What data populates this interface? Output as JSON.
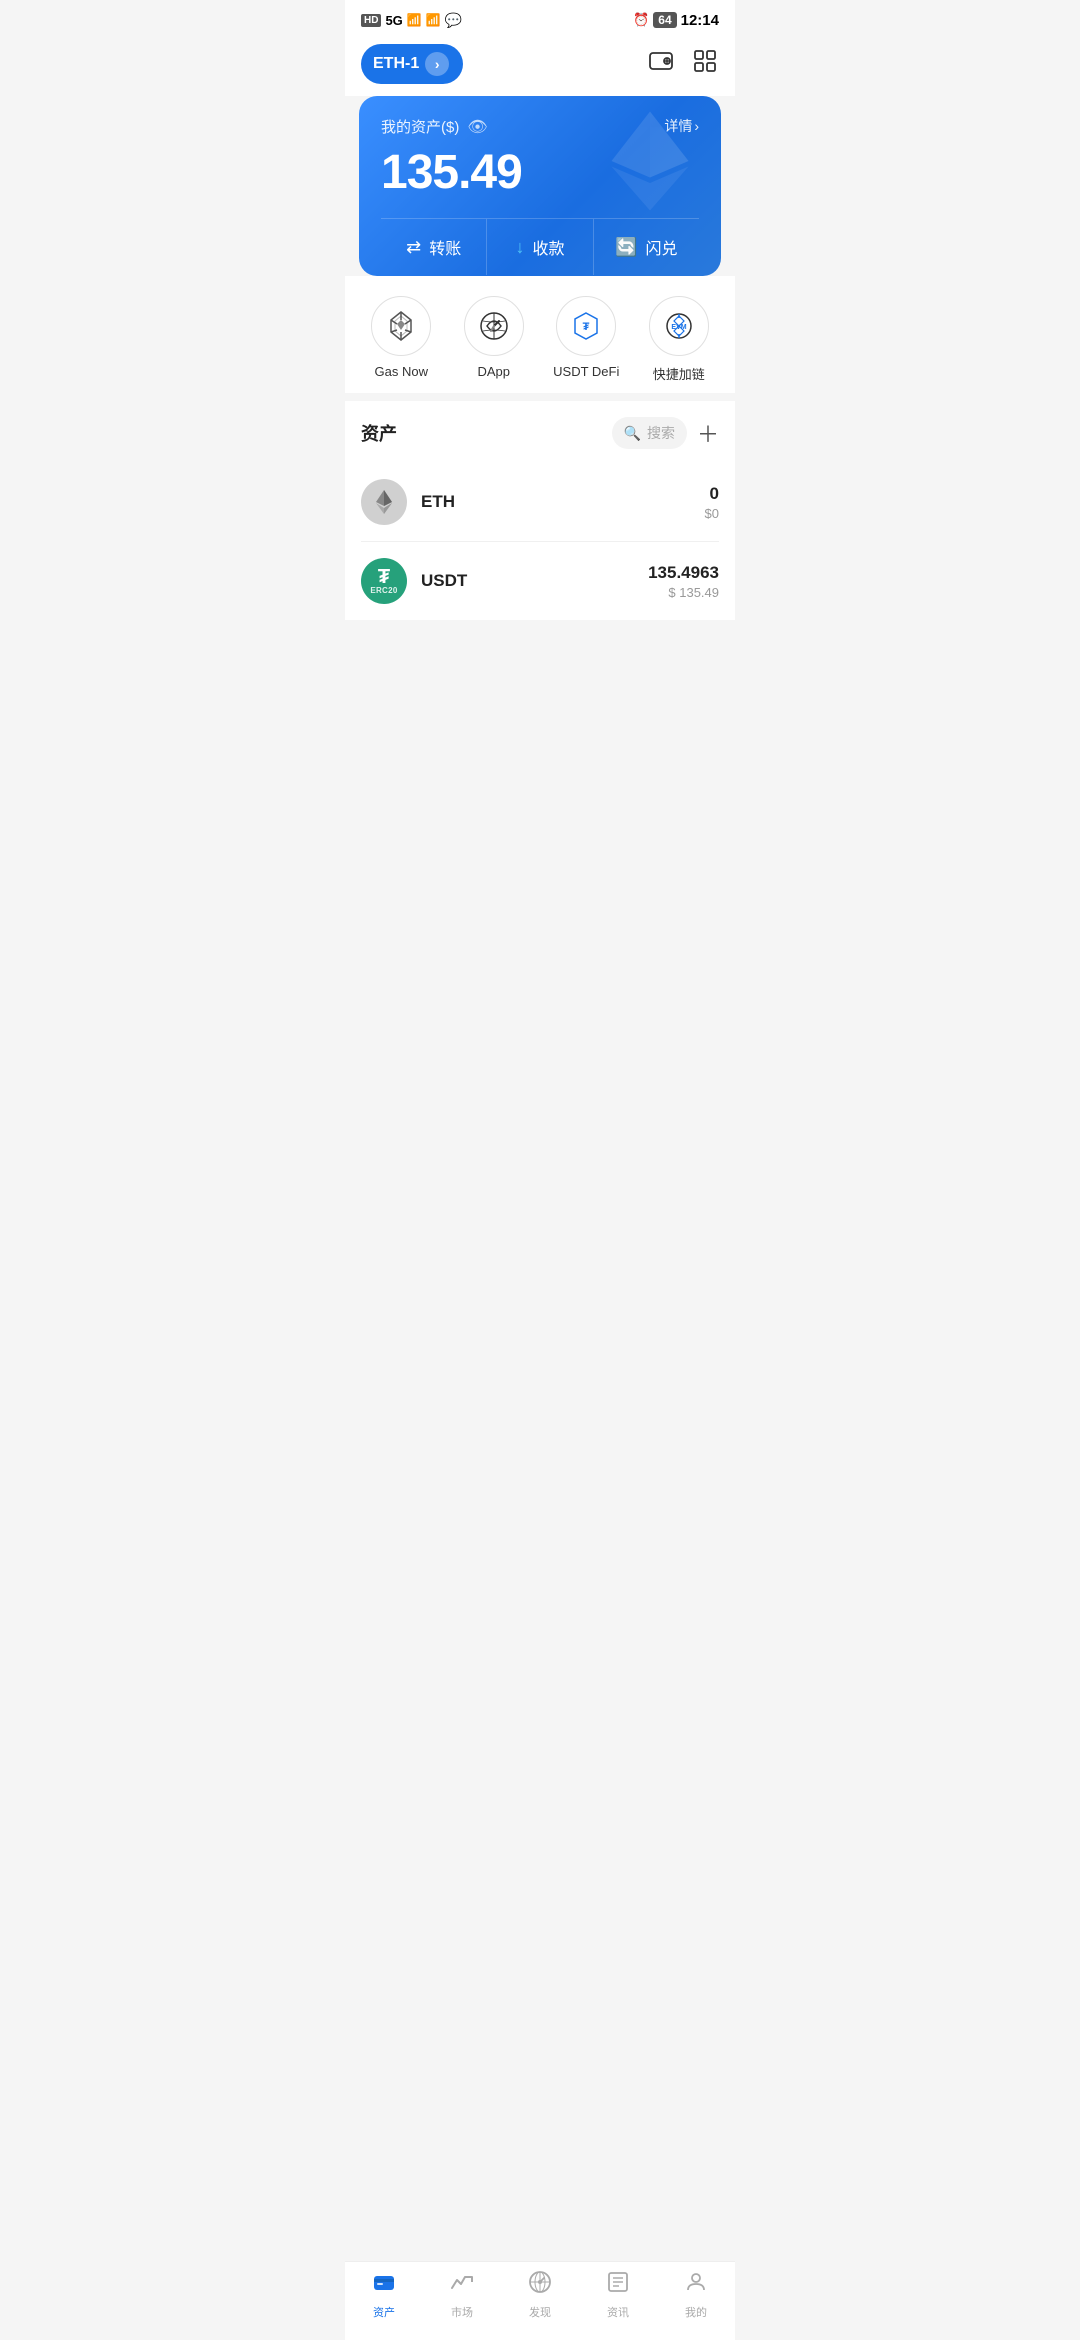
{
  "statusBar": {
    "left": "HD 5G",
    "time": "12:14",
    "battery": "64"
  },
  "header": {
    "networkLabel": "ETH-1",
    "walletIcon": "💼",
    "scanIcon": "⬛"
  },
  "assetCard": {
    "label": "我的资产($)",
    "detailText": "详情",
    "amount": "135.49",
    "actions": [
      {
        "icon": "⇄",
        "label": "转账"
      },
      {
        "icon": "↓",
        "label": "收款"
      },
      {
        "icon": "🔄",
        "label": "闪兑"
      }
    ]
  },
  "quickAccess": [
    {
      "id": "gas-now",
      "label": "Gas Now"
    },
    {
      "id": "dapp",
      "label": "DApp"
    },
    {
      "id": "usdt-defi",
      "label": "USDT DeFi"
    },
    {
      "id": "quick-chain",
      "label": "快捷加链"
    }
  ],
  "assetsSection": {
    "title": "资产",
    "searchPlaceholder": "搜索"
  },
  "tokens": [
    {
      "symbol": "ETH",
      "name": "ETH",
      "amount": "0",
      "usd": "$0"
    },
    {
      "symbol": "USDT",
      "name": "USDT",
      "amount": "135.4963",
      "usd": "$ 135.49"
    }
  ],
  "bottomNav": [
    {
      "id": "assets",
      "label": "资产",
      "active": true
    },
    {
      "id": "market",
      "label": "市场",
      "active": false
    },
    {
      "id": "discover",
      "label": "发现",
      "active": false
    },
    {
      "id": "news",
      "label": "资讯",
      "active": false
    },
    {
      "id": "profile",
      "label": "我的",
      "active": false
    }
  ]
}
